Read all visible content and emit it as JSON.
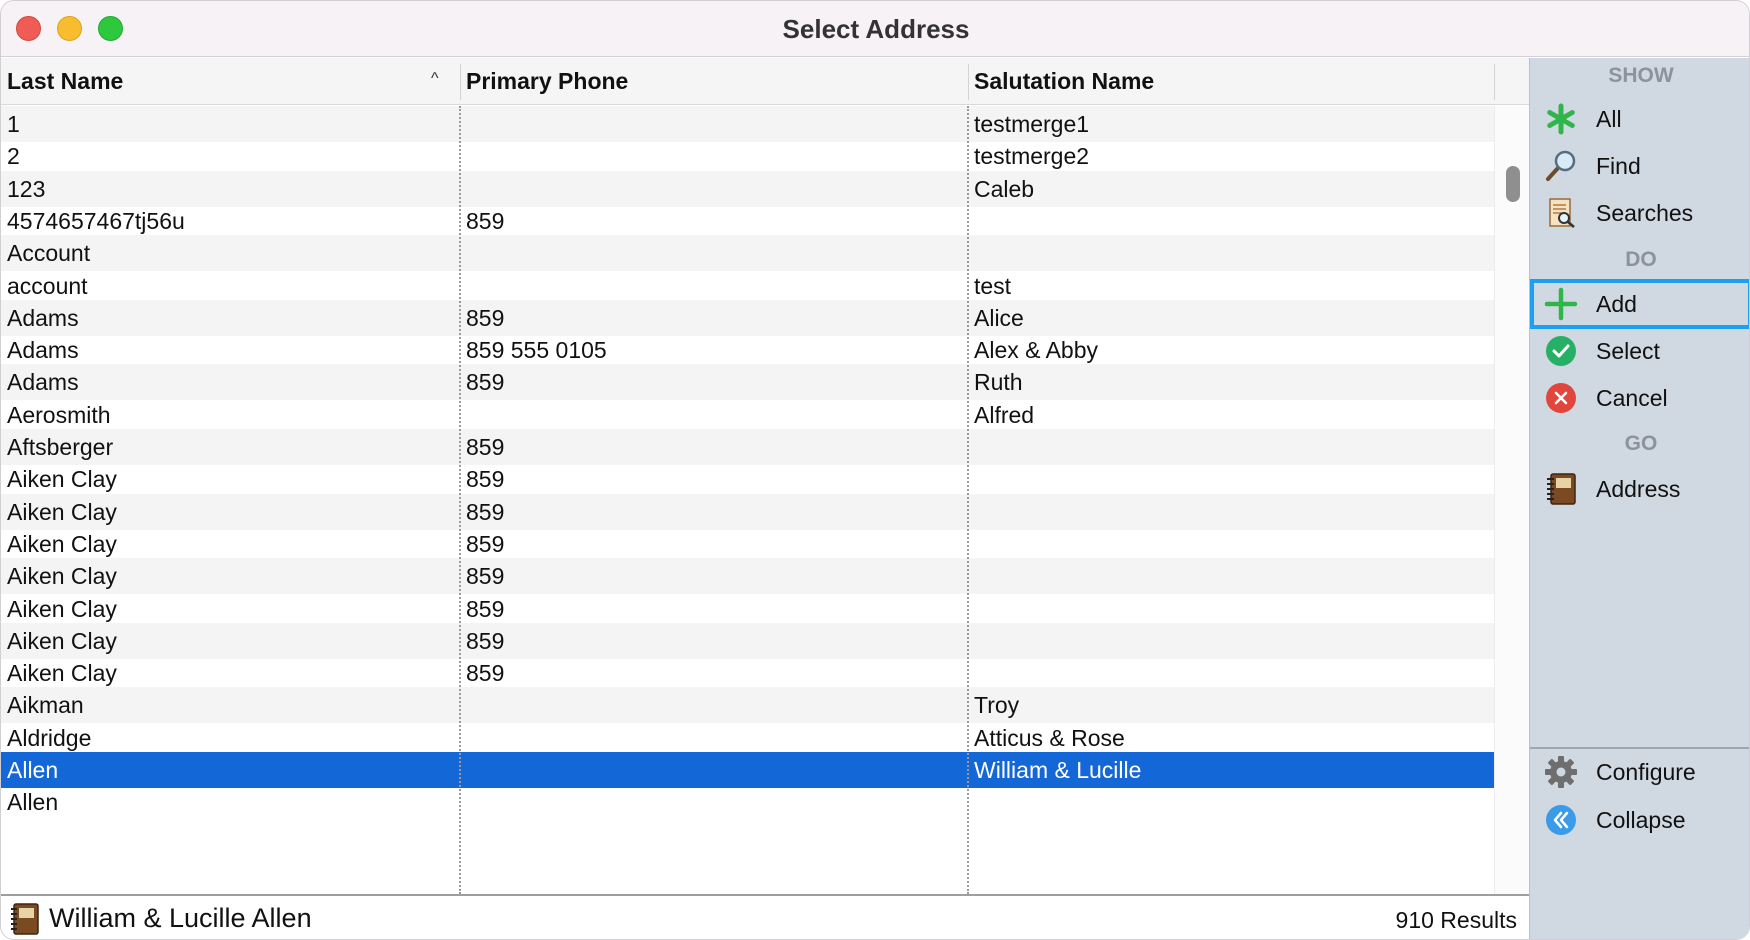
{
  "window": {
    "title": "Select Address"
  },
  "table": {
    "columns": [
      "Last Name",
      "Primary Phone",
      "Salutation Name"
    ],
    "sort_indicator": "^",
    "rows": [
      {
        "last": "1",
        "phone": "",
        "salutation": "testmerge1"
      },
      {
        "last": "2",
        "phone": "",
        "salutation": "testmerge2"
      },
      {
        "last": "123",
        "phone": "",
        "salutation": "Caleb"
      },
      {
        "last": "4574657467tj56u",
        "phone": "859",
        "salutation": ""
      },
      {
        "last": "Account",
        "phone": "",
        "salutation": ""
      },
      {
        "last": "account",
        "phone": "",
        "salutation": "test"
      },
      {
        "last": "Adams",
        "phone": "859",
        "salutation": "Alice"
      },
      {
        "last": "Adams",
        "phone": "859 555 0105",
        "salutation": "Alex & Abby"
      },
      {
        "last": "Adams",
        "phone": "859",
        "salutation": "Ruth"
      },
      {
        "last": "Aerosmith",
        "phone": "",
        "salutation": "Alfred"
      },
      {
        "last": "Aftsberger",
        "phone": "859",
        "salutation": ""
      },
      {
        "last": "Aiken Clay",
        "phone": "859",
        "salutation": ""
      },
      {
        "last": "Aiken Clay",
        "phone": "859",
        "salutation": ""
      },
      {
        "last": "Aiken Clay",
        "phone": "859",
        "salutation": ""
      },
      {
        "last": "Aiken Clay",
        "phone": "859",
        "salutation": ""
      },
      {
        "last": "Aiken Clay",
        "phone": "859",
        "salutation": ""
      },
      {
        "last": "Aiken Clay",
        "phone": "859",
        "salutation": ""
      },
      {
        "last": "Aiken Clay",
        "phone": "859",
        "salutation": ""
      },
      {
        "last": "Aikman",
        "phone": "",
        "salutation": "Troy"
      },
      {
        "last": "Aldridge",
        "phone": "",
        "salutation": "Atticus & Rose"
      },
      {
        "last": "Allen",
        "phone": "",
        "salutation": "William & Lucille",
        "selected": true
      },
      {
        "last": "Allen",
        "phone": "",
        "salutation": ""
      }
    ]
  },
  "status": {
    "selected_name": "William & Lucille Allen",
    "results": "910 Results"
  },
  "sidebar": {
    "show_header": "SHOW",
    "do_header": "DO",
    "go_header": "GO",
    "show_items": [
      {
        "label": "All",
        "icon": "asterisk-icon"
      },
      {
        "label": "Find",
        "icon": "magnifier-icon"
      },
      {
        "label": "Searches",
        "icon": "saved-search-icon"
      }
    ],
    "do_items": [
      {
        "label": "Add",
        "icon": "plus-icon"
      },
      {
        "label": "Select",
        "icon": "checkmark-icon"
      },
      {
        "label": "Cancel",
        "icon": "cancel-icon"
      }
    ],
    "go_items": [
      {
        "label": "Address",
        "icon": "address-book-icon"
      }
    ],
    "bottom_items": [
      {
        "label": "Configure",
        "icon": "gear-icon"
      },
      {
        "label": "Collapse",
        "icon": "collapse-icon"
      }
    ]
  },
  "colors": {
    "selection": "#1467d6",
    "focus_ring": "#1ea0f0",
    "sidebar_bg": "#d0d8e2",
    "add_green": "#2fb54a",
    "select_green": "#26b065",
    "cancel_red": "#e0463c"
  }
}
